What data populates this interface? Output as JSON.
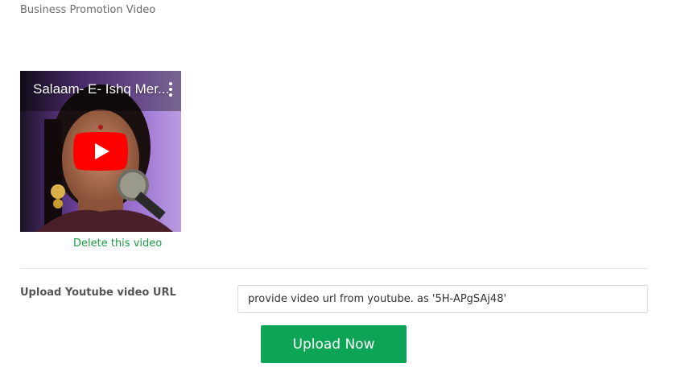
{
  "section": {
    "title": "Business Promotion Video"
  },
  "video": {
    "title": "Salaam- E- Ishq Mer...",
    "delete_label": "Delete this video"
  },
  "upload": {
    "label": "Upload Youtube video URL",
    "placeholder": "provide video url from youtube. as '5H-APgSAj48'",
    "button_label": "Upload Now"
  },
  "colors": {
    "accent_green": "#0da456",
    "link_green": "#1a9a46",
    "youtube_red": "#ff0000"
  }
}
